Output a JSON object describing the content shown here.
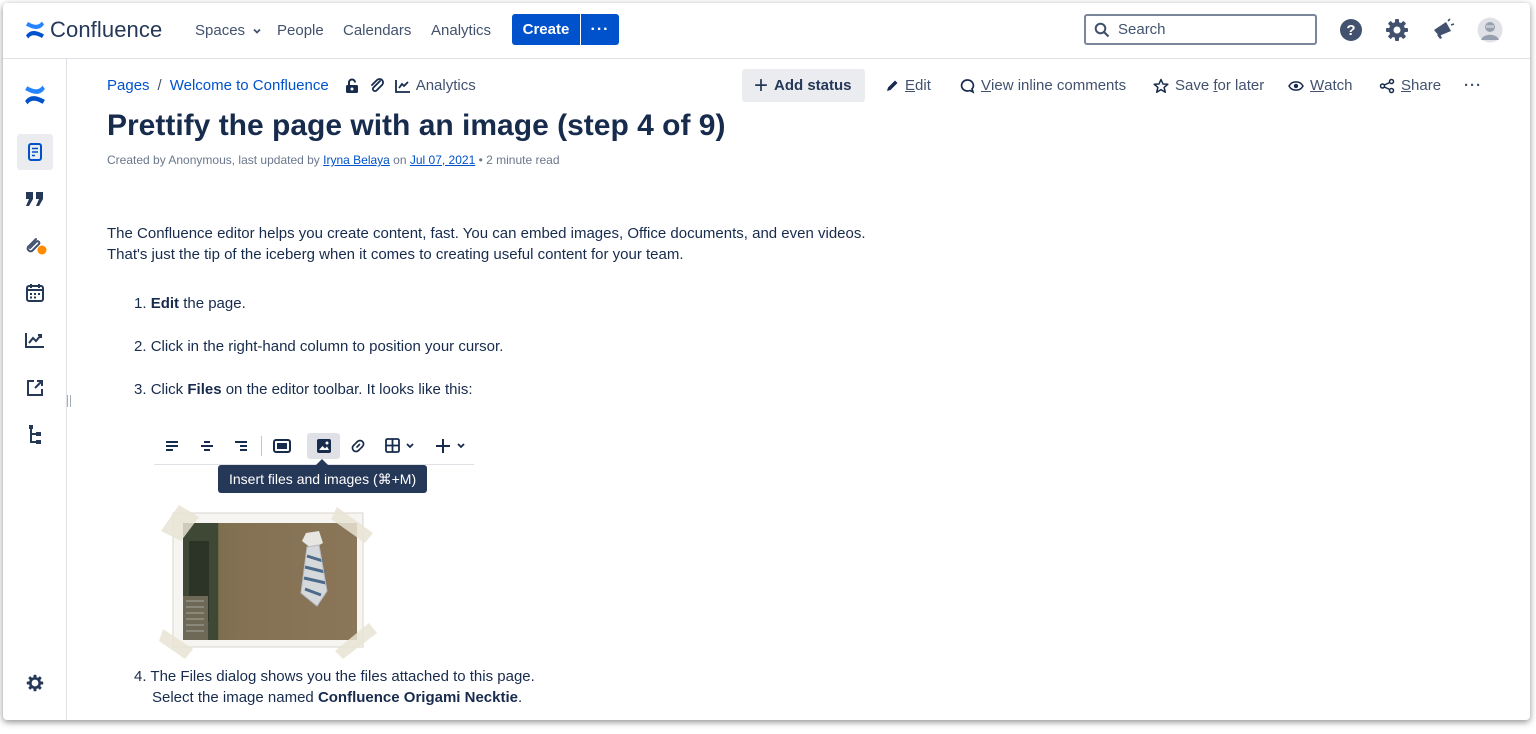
{
  "app": {
    "name": "Confluence"
  },
  "topnav": {
    "items": [
      {
        "label": "Spaces"
      },
      {
        "label": "People"
      },
      {
        "label": "Calendars"
      },
      {
        "label": "Analytics"
      }
    ],
    "create_label": "Create",
    "more_label": "···",
    "search_placeholder": "Search"
  },
  "breadcrumb": {
    "pages": "Pages",
    "separator": "/",
    "parent": "Welcome to Confluence",
    "analytics": "Analytics"
  },
  "actions": {
    "add_status": "Add status",
    "edit": {
      "pre": "",
      "u": "E",
      "post": "dit"
    },
    "inline_comments": {
      "pre": "",
      "u": "V",
      "post": "iew inline comments"
    },
    "save_later": {
      "pre": "Save ",
      "u": "f",
      "post": "or later"
    },
    "watch": {
      "pre": "",
      "u": "W",
      "post": "atch"
    },
    "share": {
      "pre": "",
      "u": "S",
      "post": "hare"
    },
    "more": "···"
  },
  "page": {
    "title": "Prettify the page with an image (step 4 of 9)",
    "byline_prefix": "Created by Anonymous, last updated by ",
    "byline_author": "Iryna Belaya",
    "byline_on": " on ",
    "byline_date": "Jul 07, 2021",
    "byline_suffix": " • 2 minute read",
    "intro_line1": "The Confluence editor helps you create content, fast. You can embed images, Office documents, and even videos.",
    "intro_line2": "That's just the tip of the iceberg when it comes to creating useful content for your team."
  },
  "steps": [
    {
      "num": "1. ",
      "bold": "Edit",
      "text": " the page."
    },
    {
      "num": "2. ",
      "bold": "",
      "text": "Click in the right-hand column to position your cursor."
    },
    {
      "num": "3. ",
      "pre": "Click ",
      "bold": "Files",
      "text": " on the editor toolbar. It looks like this:"
    },
    {
      "num": "4. ",
      "line1": "The Files dialog shows you the files attached to this page.",
      "line2_pre": "Select the image named ",
      "line2_bold": "Confluence Origami Necktie",
      "line2_post": "."
    }
  ],
  "tooltip": "Insert files and images (⌘+M)",
  "colors": {
    "brand_blue": "#0052cc",
    "text_dark": "#172b4d",
    "text_muted": "#42526e",
    "orange_badge": "#ff8b00",
    "tooltip_bg": "#253858"
  }
}
